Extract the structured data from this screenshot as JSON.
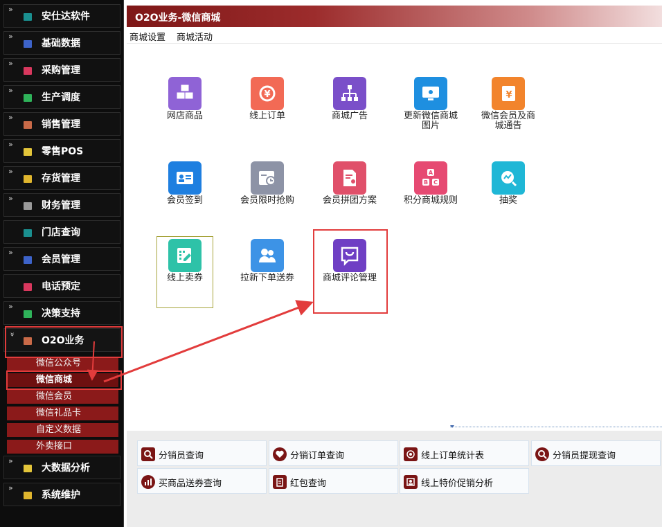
{
  "sidebar": {
    "items": [
      {
        "label": "安仕达软件",
        "icon": "tree-icon",
        "color": "#1a8f8f"
      },
      {
        "label": "基础数据",
        "icon": "database-icon",
        "color": "#3d63c9"
      },
      {
        "label": "采购管理",
        "icon": "cart-icon",
        "color": "#d9385e"
      },
      {
        "label": "生产调度",
        "icon": "factory-icon",
        "color": "#2fb35a"
      },
      {
        "label": "销售管理",
        "icon": "sales-icon",
        "color": "#c96a48"
      },
      {
        "label": "零售POS",
        "icon": "pos-icon",
        "color": "#e3c53a"
      },
      {
        "label": "存货管理",
        "icon": "box-icon",
        "color": "#e0b62e"
      },
      {
        "label": "财务管理",
        "icon": "finance-icon",
        "color": "#9a9a9a"
      },
      {
        "label": "门店查询",
        "icon": "store-icon",
        "color": "#1a8f8f"
      },
      {
        "label": "会员管理",
        "icon": "member-icon",
        "color": "#3d63c9"
      },
      {
        "label": "电话预定",
        "icon": "phone-icon",
        "color": "#d9385e"
      },
      {
        "label": "决策支持",
        "icon": "decision-icon",
        "color": "#2fb35a"
      },
      {
        "label": "O2O业务",
        "icon": "o2o-icon",
        "color": "#c96a48"
      },
      {
        "label": "大数据分析",
        "icon": "bigdata-icon",
        "color": "#e3c53a"
      },
      {
        "label": "系统维护",
        "icon": "settings-icon",
        "color": "#e0b62e"
      }
    ],
    "o2o_sub": [
      "微信公众号",
      "微信商城",
      "微信会员",
      "微信礼品卡",
      "自定义数据",
      "外卖接口"
    ]
  },
  "header": {
    "title": "O2O业务-微信商城"
  },
  "menubar": {
    "items": [
      "商城设置",
      "商城活动"
    ]
  },
  "tiles": [
    {
      "label": "网店商品",
      "icon": "cubes-icon",
      "color": "#8f63d6"
    },
    {
      "label": "线上订单",
      "icon": "yen-refresh-icon",
      "color": "#f26a55"
    },
    {
      "label": "商城广告",
      "icon": "sitemap-icon",
      "color": "#7a4fc9"
    },
    {
      "label": "更新微信商城图片",
      "icon": "monitor-icon",
      "color": "#1e8fe0"
    },
    {
      "label": "微信会员及商城通告",
      "icon": "notice-icon",
      "color": "#f2842c"
    },
    {
      "label": "会员签到",
      "icon": "id-card-icon",
      "color": "#1e7fe0"
    },
    {
      "label": "会员限时抢购",
      "icon": "calendar-clock-icon",
      "color": "#8d93a6"
    },
    {
      "label": "会员拼团方案",
      "icon": "document-user-icon",
      "color": "#e0506a"
    },
    {
      "label": "积分商城规则",
      "icon": "abc-icon",
      "color": "#e64a72"
    },
    {
      "label": "抽奖",
      "icon": "chart-search-icon",
      "color": "#1fb7d6"
    },
    {
      "label": "线上卖券",
      "icon": "edit-grid-icon",
      "color": "#2ec2a8"
    },
    {
      "label": "拉新下单送券",
      "icon": "users-icon",
      "color": "#3d93e6"
    },
    {
      "label": "商城评论管理",
      "icon": "comment-icon",
      "color": "#6f3fc4"
    }
  ],
  "reports": [
    {
      "label": "分销员查询",
      "icon": "search-doc-icon"
    },
    {
      "label": "分销订单查询",
      "icon": "heart-icon"
    },
    {
      "label": "线上订单统计表",
      "icon": "at-icon"
    },
    {
      "label": "分销员提现查询",
      "icon": "search-icon"
    },
    {
      "label": "买商品送券查询",
      "icon": "bar-chart-icon"
    },
    {
      "label": "红包查询",
      "icon": "clipboard-icon"
    },
    {
      "label": "线上特价促销分析",
      "icon": "contact-icon"
    }
  ],
  "colors": {
    "accent_red": "#e23c3c",
    "dark_red": "#7e1717"
  }
}
